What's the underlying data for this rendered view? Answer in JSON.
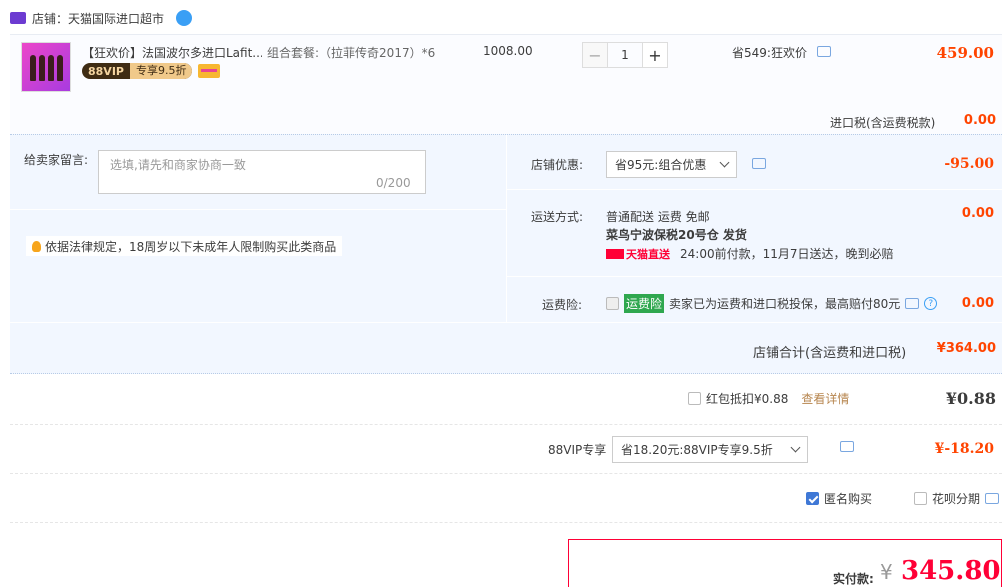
{
  "shop": {
    "label": "店铺：天猫国际进口超市"
  },
  "item": {
    "title": "【狂欢价】法国波尔多进口Lafit...",
    "combo": "组合套餐:（拉菲传奇2017）*6",
    "vip_text": "88VIP",
    "vip_discount": "专享9.5折",
    "unit_price": "1008.00",
    "quantity": "1",
    "qty_minus": "−",
    "qty_plus": "+",
    "promo": "省549:狂欢价",
    "total": "459.00"
  },
  "tax": {
    "label": "进口税(含运费税款)",
    "value": "0.00"
  },
  "note": {
    "label": "给卖家留言:",
    "placeholder": "选填,请先和商家协商一致",
    "count": "0/200"
  },
  "legal_notice": "依据法律规定，18周岁以下未成年人限制购买此类商品",
  "shop_discount": {
    "label": "店铺优惠:",
    "selected": "省95元:组合优惠",
    "value": "-95.00"
  },
  "shipping": {
    "label": "运送方式:",
    "line1": "普通配送 运费 免邮",
    "line2": "菜鸟宁波保税20号仓   发货",
    "tmall_tag": "天猫直送",
    "line3": "24:00前付款，11月7日送达，晚到必赔",
    "value": "0.00"
  },
  "insurance": {
    "label": "运费险:",
    "tag": "运费险",
    "text": "卖家已为运费和进口税投保，最高赔付80元",
    "value": "0.00"
  },
  "store_total": {
    "label": "店铺合计(含运费和进口税)",
    "value": "¥364.00"
  },
  "hongbao": {
    "label": "红包抵扣¥0.88",
    "link": "查看详情",
    "value": "¥0.88"
  },
  "vip": {
    "label": "88VIP专享",
    "selected": "省18.20元:88VIP专享9.5折",
    "value": "¥-18.20"
  },
  "options": {
    "anonymous": "匿名购买",
    "huabei": "花呗分期"
  },
  "pay": {
    "label": "实付款:",
    "yen": "¥",
    "value": "345.80"
  },
  "colors": {
    "price_red": "#ff4400",
    "accent_blue": "#3a9ff5",
    "band_bg": "#f2f7ff"
  }
}
